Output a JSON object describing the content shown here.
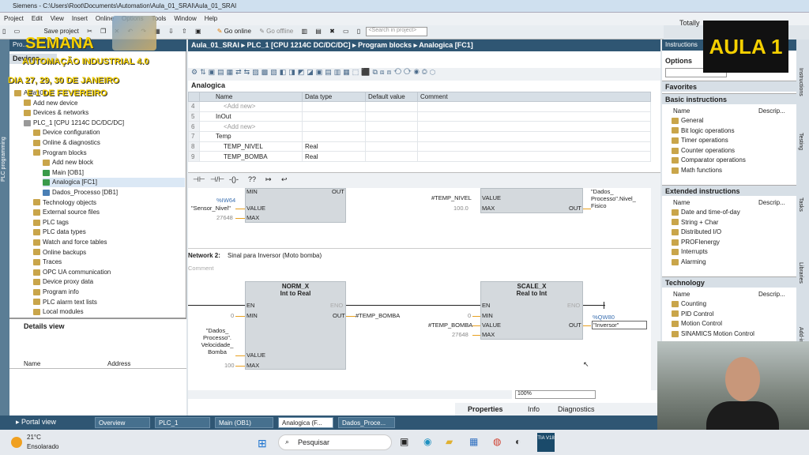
{
  "window": {
    "title": "Siemens - C:\\Users\\Root\\Documents\\Automation\\Aula_01_SRAI\\Aula_01_SRAI"
  },
  "menu": [
    "Project",
    "Edit",
    "View",
    "Insert",
    "Online",
    "Options",
    "Tools",
    "Window",
    "Help"
  ],
  "toolbar": {
    "save": "Save project",
    "go_online": "Go online",
    "go_offline": "Go offline",
    "search_placeholder": "<Search in project>"
  },
  "header_right": "Totally",
  "overlay": {
    "semana": "SEMANA",
    "line1": "AUTOMAÇÃO INDUSTRIAL 4.0",
    "line2": "DIA 27, 29, 30 DE JANEIRO",
    "line3": "E 1 DE FEVEREIRO",
    "aula": "AULA 1"
  },
  "left": {
    "side_tab": "PLC programming",
    "panel_title": "Pro...",
    "devices_tab": "Devices",
    "tree": [
      {
        "label": "Aula_01...",
        "indent": 0
      },
      {
        "label": "Add new device",
        "indent": 1
      },
      {
        "label": "Devices & networks",
        "indent": 1
      },
      {
        "label": "PLC_1 [CPU 1214C DC/DC/DC]",
        "indent": 1
      },
      {
        "label": "Device configuration",
        "indent": 2
      },
      {
        "label": "Online & diagnostics",
        "indent": 2
      },
      {
        "label": "Program blocks",
        "indent": 2
      },
      {
        "label": "Add new block",
        "indent": 3
      },
      {
        "label": "Main [OB1]",
        "indent": 3
      },
      {
        "label": "Analogica [FC1]",
        "indent": 3
      },
      {
        "label": "Dados_Processo [DB1]",
        "indent": 3
      },
      {
        "label": "Technology objects",
        "indent": 2
      },
      {
        "label": "External source files",
        "indent": 2
      },
      {
        "label": "PLC tags",
        "indent": 2
      },
      {
        "label": "PLC data types",
        "indent": 2
      },
      {
        "label": "Watch and force tables",
        "indent": 2
      },
      {
        "label": "Online backups",
        "indent": 2
      },
      {
        "label": "Traces",
        "indent": 2
      },
      {
        "label": "OPC UA communication",
        "indent": 2
      },
      {
        "label": "Device proxy data",
        "indent": 2
      },
      {
        "label": "Program info",
        "indent": 2
      },
      {
        "label": "PLC alarm text lists",
        "indent": 2
      },
      {
        "label": "Local modules",
        "indent": 2
      }
    ],
    "details_title": "Details view",
    "details_cols": [
      "Name",
      "Address"
    ]
  },
  "editor": {
    "breadcrumb": "Aula_01_SRAI  ▸  PLC_1 [CPU 1214C DC/DC/DC]  ▸  Program blocks  ▸  Analogica [FC1]",
    "block_name": "Analogica",
    "var_cols": [
      "Name",
      "Data type",
      "Default value",
      "Comment"
    ],
    "vars": [
      {
        "n": "4",
        "name": "<Add new>",
        "type": "",
        "def": "",
        "comment": ""
      },
      {
        "n": "5",
        "name": "InOut",
        "type": "",
        "def": "",
        "comment": ""
      },
      {
        "n": "6",
        "name": "<Add new>",
        "type": "",
        "def": "",
        "comment": ""
      },
      {
        "n": "7",
        "name": "Temp",
        "type": "",
        "def": "",
        "comment": ""
      },
      {
        "n": "8",
        "name": "TEMP_NIVEL",
        "type": "Real",
        "def": "",
        "comment": ""
      },
      {
        "n": "9",
        "name": "TEMP_BOMBA",
        "type": "Real",
        "def": "",
        "comment": ""
      }
    ],
    "instr_icons": [
      "⊣⊢",
      "⊣/⊢",
      "-()-",
      "??",
      "↦",
      "↩"
    ],
    "net1": {
      "sym_iw": "%IW64",
      "sensor": "\"Sensor_Nivel\"",
      "value_pin": "VALUE",
      "max_pin": "MAX",
      "max_val": "27648",
      "min_pin": "MIN",
      "out_pin": "OUT",
      "temp_nivel": "#TEMP_NIVEL",
      "scale_max": "100.0",
      "dest": "\"Dados_ Processo\".Nivel_ Fisico"
    },
    "net2": {
      "label": "Network 2:",
      "title": "Sinal para Inversor (Moto bomba)",
      "comment": "Comment",
      "norm_title1": "NORM_X",
      "norm_title2": "Int to Real",
      "scale_title1": "SCALE_X",
      "scale_title2": "Real to Int",
      "en": "EN",
      "eno": "ENO",
      "min": "MIN",
      "value": "VALUE",
      "max": "MAX",
      "out": "OUT",
      "norm_min_val": "0",
      "norm_value_src": "\"Dados_ Processo\". Velocidade_ Bomba",
      "norm_max_val": "100",
      "norm_out": "#TEMP_BOMBA",
      "scale_min_val": "0",
      "scale_value_src": "#TEMP_BOMBA",
      "scale_max_val": "27648",
      "qw": "%QW80",
      "inversor": "\"Inversor\""
    },
    "zoom": "100%"
  },
  "right": {
    "title": "Instructions",
    "options": "Options",
    "favorites": "Favorites",
    "basic": "Basic instructions",
    "col_name": "Name",
    "col_desc": "Descrip...",
    "basic_items": [
      "General",
      "Bit logic operations",
      "Timer operations",
      "Counter operations",
      "Comparator operations",
      "Math functions"
    ],
    "extended": "Extended instructions",
    "ext_items": [
      "Date and time-of-day",
      "String + Char",
      "Distributed I/O",
      "PROFIenergy",
      "Interrupts",
      "Alarming"
    ],
    "technology": "Technology",
    "tech_items": [
      "Counting",
      "PID Control",
      "Motion Control",
      "SINAMICS Motion Control"
    ],
    "side_tabs": [
      "Instructions",
      "Testing",
      "Tasks",
      "Libraries",
      "Add-ins"
    ]
  },
  "bottom": {
    "properties": "Properties",
    "info": "Info",
    "diagnostics": "Diagnostics",
    "portal_view": "Portal view",
    "tabs": [
      "Overview",
      "PLC_1",
      "Main (OB1)",
      "Analogica (F...",
      "Dados_Proce..."
    ]
  },
  "taskbar": {
    "temp": "21°C",
    "weather": "Ensolarado",
    "search": "Pesquisar",
    "tia": "TIA V18"
  },
  "colors": {
    "accent": "#2f5673",
    "overlay_yellow": "#f5d000"
  }
}
